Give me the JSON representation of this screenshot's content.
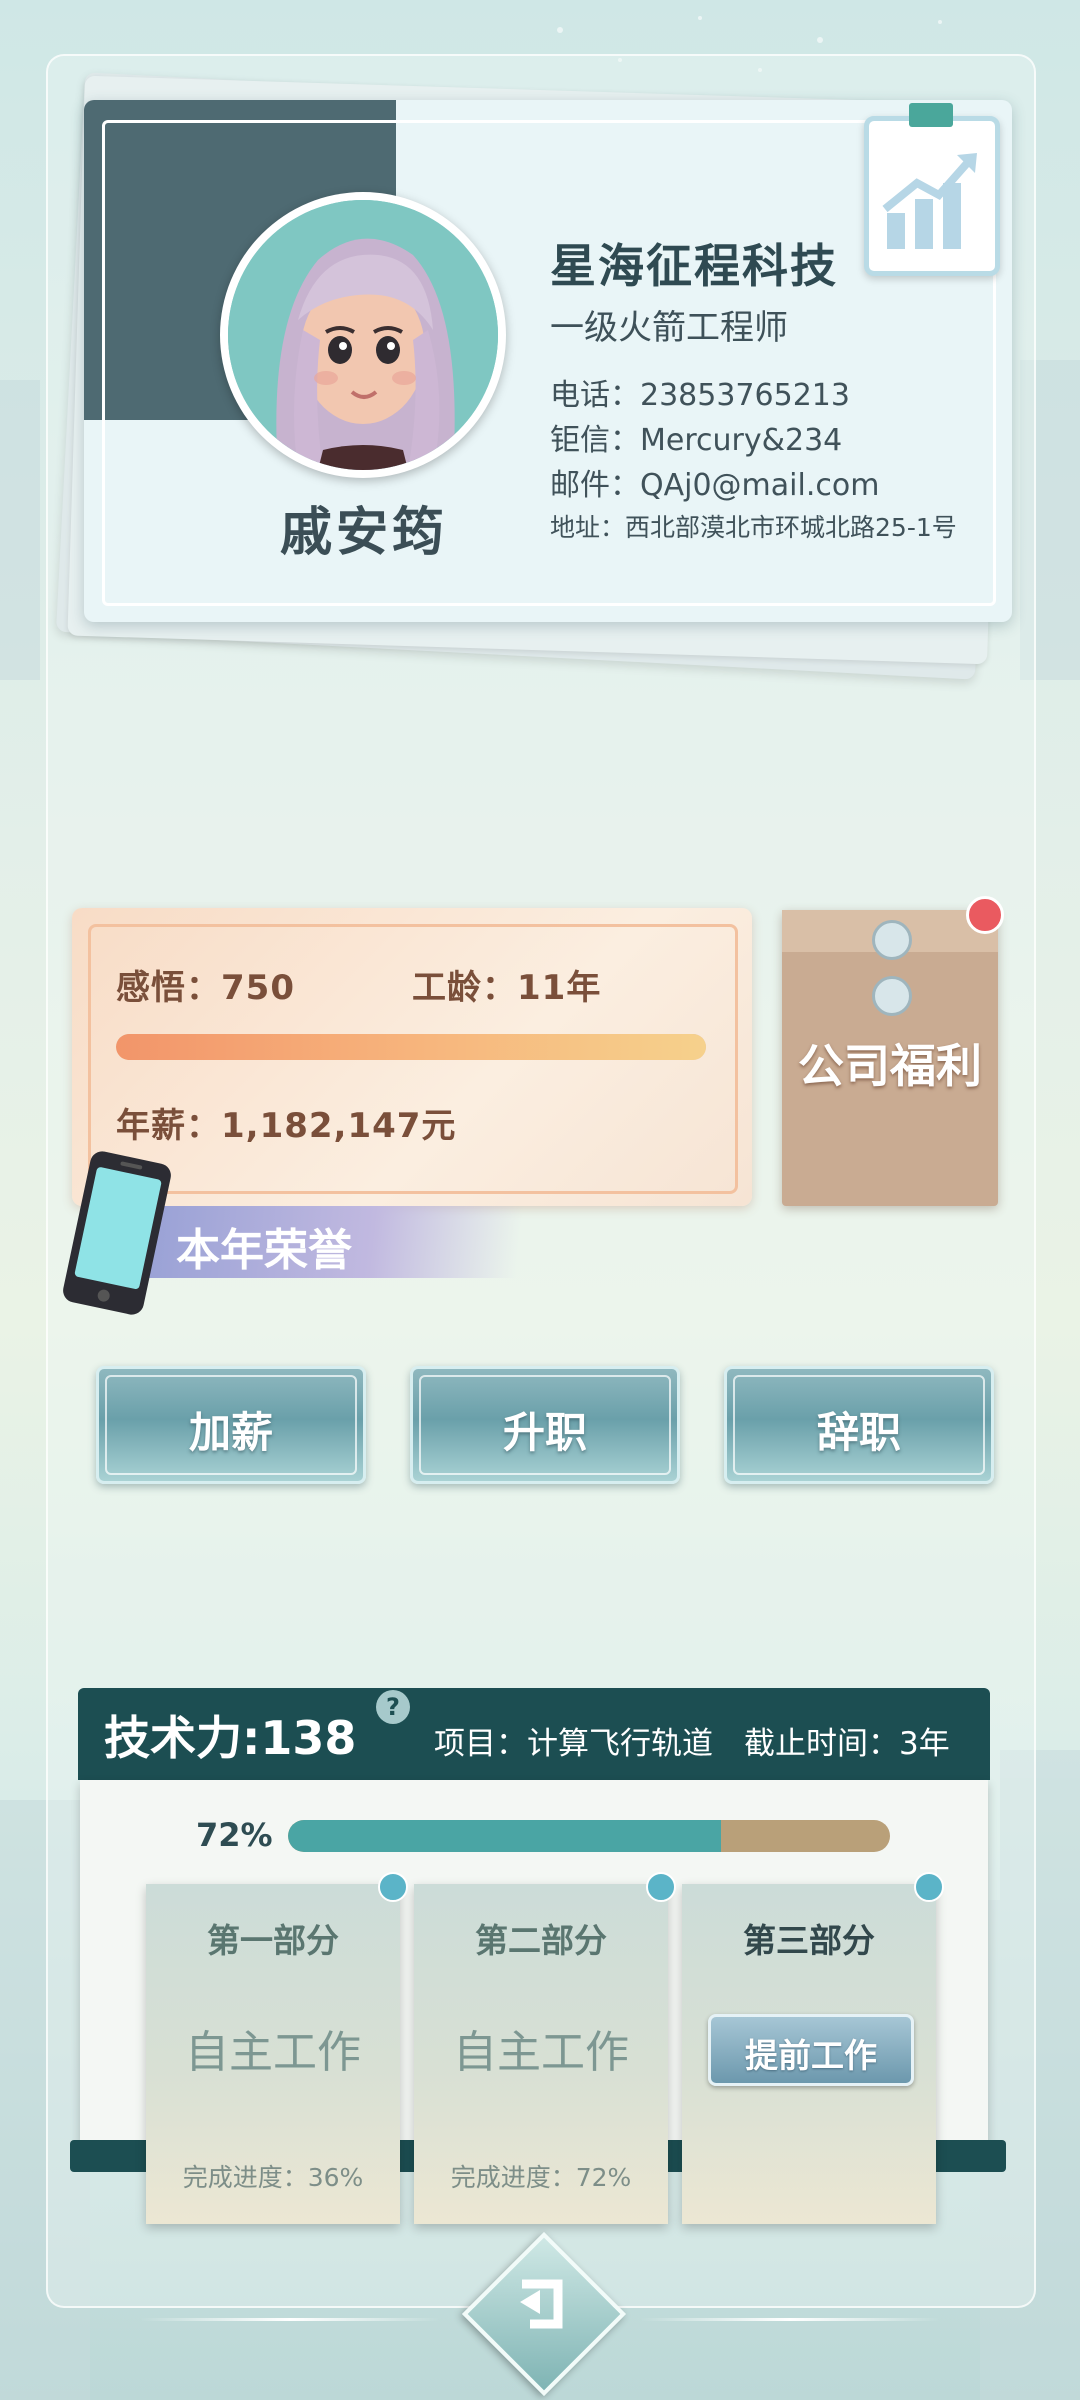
{
  "profile": {
    "name": "戚安筠",
    "company": "星海征程科技",
    "title": "一级火箭工程师",
    "phone": "电话：23853765213",
    "message": "钜信：Mercury&234",
    "email": "邮件：QAj0@mail.com",
    "address": "地址：西北部漠北市环城北路25-1号"
  },
  "stats": {
    "insight_label": "感悟：750",
    "seniority_label": "工龄：11年",
    "salary_label": "年薪：1,182,147元",
    "progress": 1.0,
    "welfare_label": "公司福利",
    "honor_label": "本年荣誉"
  },
  "actions": {
    "raise": "加薪",
    "promote": "升职",
    "resign": "辞职"
  },
  "project": {
    "tech_power": "技术力:138",
    "help": "?",
    "info": "项目：计算飞行轨道　截止时间：3年",
    "progress_text": "72%",
    "progress": 0.72,
    "parts": [
      {
        "title": "第一部分",
        "status": "自主工作",
        "progress_text": "完成进度：36%"
      },
      {
        "title": "第二部分",
        "status": "自主工作",
        "progress_text": "完成进度：72%"
      },
      {
        "title": "第三部分",
        "button": "提前工作"
      }
    ]
  },
  "icons": {
    "back": "back-arrow-icon",
    "growth_chart": "growth-chart-icon",
    "phone": "phone-icon"
  },
  "colors": {
    "accent_teal": "#1c4e52",
    "bar_teal": "#4aa5a4",
    "bar_tan": "#b9a079",
    "stat_orange": "#f2956a",
    "notification": "#ea5a60"
  }
}
